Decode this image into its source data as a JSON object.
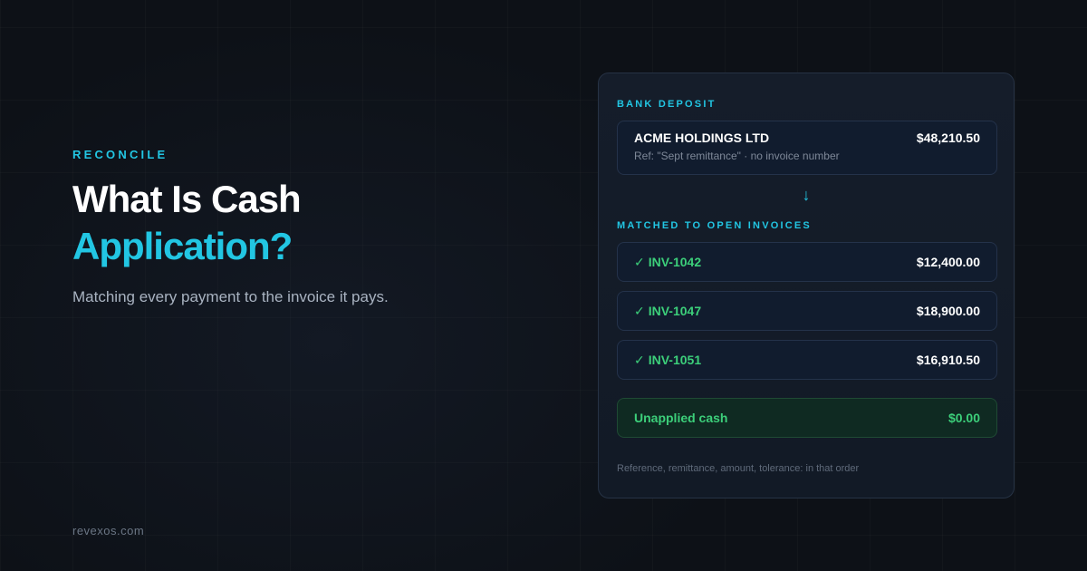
{
  "hero": {
    "eyebrow": "RECONCILE",
    "title_line1": "What Is Cash",
    "title_line2": "Application?",
    "subtitle": "Matching every payment to the invoice it pays."
  },
  "footer": {
    "site": "revexos.com"
  },
  "card": {
    "deposit_label": "BANK DEPOSIT",
    "deposit": {
      "payer": "ACME HOLDINGS LTD",
      "amount": "$48,210.50",
      "reference": "Ref: \"Sept remittance\" · no invoice number"
    },
    "arrow_icon": "arrow-down-icon",
    "matched_label": "MATCHED TO OPEN INVOICES",
    "invoices": [
      {
        "id": "INV-1042",
        "amount": "$12,400.00"
      },
      {
        "id": "INV-1047",
        "amount": "$18,900.00"
      },
      {
        "id": "INV-1051",
        "amount": "$16,910.50"
      }
    ],
    "unapplied": {
      "label": "Unapplied cash",
      "amount": "$0.00"
    },
    "note": "Reference, remittance, amount, tolerance: in that order"
  },
  "colors": {
    "accent": "#22c6e3",
    "success": "#3ccf7a",
    "background": "#0d1117"
  }
}
